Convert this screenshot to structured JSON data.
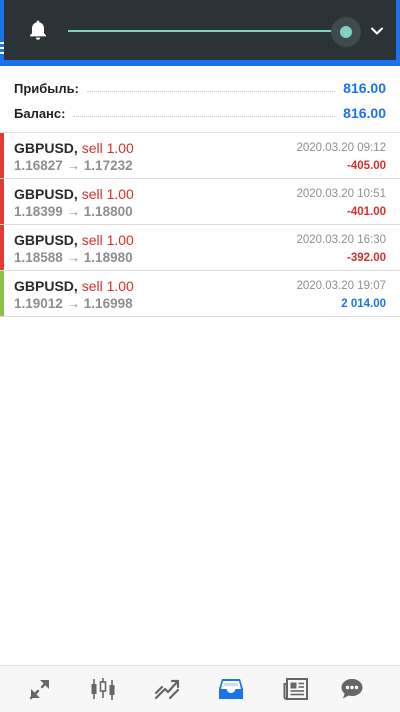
{
  "colors": {
    "accent": "#1a73e8",
    "loss": "#d32f2f",
    "gain": "#1a73e8",
    "sell_bar": "#e53935",
    "profit_bar": "#8bc34a",
    "panel_bg": "#2b3336",
    "slider": "#7fd1c3"
  },
  "icons": {
    "notification": "bell-icon",
    "expand": "chevron-down-icon",
    "nav": [
      "quotes-icon",
      "chart-icon",
      "trade-icon",
      "history-icon",
      "news-icon",
      "chat-icon"
    ]
  },
  "slider": {
    "level": 1.0
  },
  "summary": {
    "profit_label": "Прибыль:",
    "profit_value": "816.00",
    "balance_label": "Баланс:",
    "balance_value": "816.00"
  },
  "trades": [
    {
      "symbol": "GBPUSD,",
      "action": "sell 1.00",
      "prices": "1.16827 → 1.17232",
      "time": "2020.03.20 09:12",
      "profit": "-405.00",
      "profit_color": "#d32f2f",
      "bar_color": "#e53935"
    },
    {
      "symbol": "GBPUSD,",
      "action": "sell 1.00",
      "prices": "1.18399 → 1.18800",
      "time": "2020.03.20 10:51",
      "profit": "-401.00",
      "profit_color": "#d32f2f",
      "bar_color": "#e53935"
    },
    {
      "symbol": "GBPUSD,",
      "action": "sell 1.00",
      "prices": "1.18588 → 1.18980",
      "time": "2020.03.20 16:30",
      "profit": "-392.00",
      "profit_color": "#d32f2f",
      "bar_color": "#e53935"
    },
    {
      "symbol": "GBPUSD,",
      "action": "sell 1.00",
      "prices": "1.19012 → 1.16998",
      "time": "2020.03.20 19:07",
      "profit": "2 014.00",
      "profit_color": "#1a73e8",
      "bar_color": "#8bc34a"
    }
  ],
  "bottom_nav": {
    "active_index": 3
  }
}
